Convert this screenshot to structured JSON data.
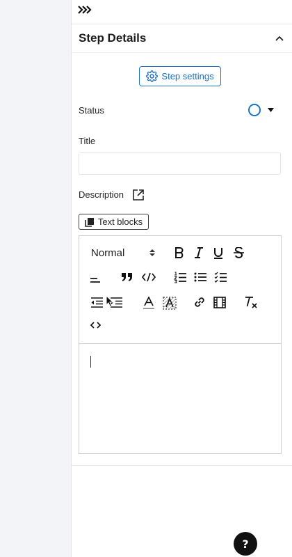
{
  "panel": {
    "section_title": "Step Details",
    "step_settings_label": "Step settings",
    "status_label": "Status",
    "title_label": "Title",
    "title_value": "",
    "title_placeholder": "",
    "description_label": "Description",
    "text_blocks_label": "Text blocks"
  },
  "editor": {
    "header_format": "Normal",
    "content": ""
  },
  "help": {
    "label": "?"
  },
  "colors": {
    "accent": "#1a73c9",
    "panel_bg": "#ffffff",
    "page_bg": "#f3f4f7"
  },
  "icons": {
    "collapse": "chevron-double-right-icon",
    "section_toggle": "chevron-up-icon",
    "settings": "gear-icon",
    "status": "empty-circle-icon",
    "status_dropdown": "caret-down-icon",
    "external": "external-link-icon",
    "text_blocks": "copy-icon"
  }
}
